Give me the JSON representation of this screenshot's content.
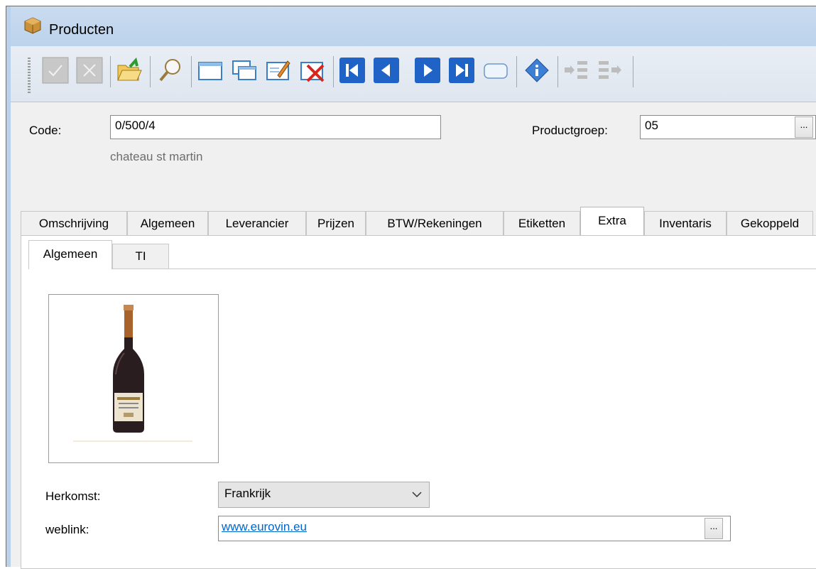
{
  "window": {
    "title": "Producten",
    "title_icon": "box-icon"
  },
  "toolbar": {
    "buttons": [
      {
        "name": "confirm-button",
        "icon": "checkmark-icon"
      },
      {
        "name": "cancel-button",
        "icon": "x-icon"
      },
      {
        "name": "open-folder-button",
        "icon": "folder-open-icon"
      },
      {
        "name": "search-button",
        "icon": "magnifier-icon"
      },
      {
        "name": "new-record-button",
        "icon": "new-window-icon"
      },
      {
        "name": "copy-record-button",
        "icon": "copy-windows-icon"
      },
      {
        "name": "edit-record-button",
        "icon": "edit-icon"
      },
      {
        "name": "delete-record-button",
        "icon": "delete-icon"
      },
      {
        "name": "first-record-button",
        "icon": "first-icon"
      },
      {
        "name": "previous-record-button",
        "icon": "previous-icon"
      },
      {
        "name": "next-record-button",
        "icon": "next-icon"
      },
      {
        "name": "last-record-button",
        "icon": "last-icon"
      },
      {
        "name": "blank-button",
        "icon": "rounded-rect-icon"
      },
      {
        "name": "info-button",
        "icon": "info-icon"
      },
      {
        "name": "link-in-button",
        "icon": "link-in-icon"
      },
      {
        "name": "link-out-button",
        "icon": "link-out-icon"
      }
    ]
  },
  "header": {
    "code_label": "Code:",
    "code_value": "0/500/4",
    "description": "chateau st martin",
    "productgroep_label": "Productgroep:",
    "productgroep_value": "05",
    "ellipsis": "..."
  },
  "tabs": [
    {
      "label": "Omschrijving"
    },
    {
      "label": "Algemeen"
    },
    {
      "label": "Leverancier"
    },
    {
      "label": "Prijzen"
    },
    {
      "label": "BTW/Rekeningen"
    },
    {
      "label": "Etiketten"
    },
    {
      "label": "Extra",
      "active": true
    },
    {
      "label": "Inventaris"
    },
    {
      "label": "Gekoppeld"
    }
  ],
  "subtabs": [
    {
      "label": "Algemeen",
      "active": true
    },
    {
      "label": "TI"
    }
  ],
  "extra": {
    "herkomst_label": "Herkomst:",
    "herkomst_value": "Frankrijk",
    "weblink_label": "weblink:",
    "weblink_value": "www.eurovin.eu",
    "ellipsis": "..."
  },
  "colors": {
    "titlebar": "#c9dbef",
    "nav_blue": "#1f63c6",
    "link": "#0066cc"
  }
}
